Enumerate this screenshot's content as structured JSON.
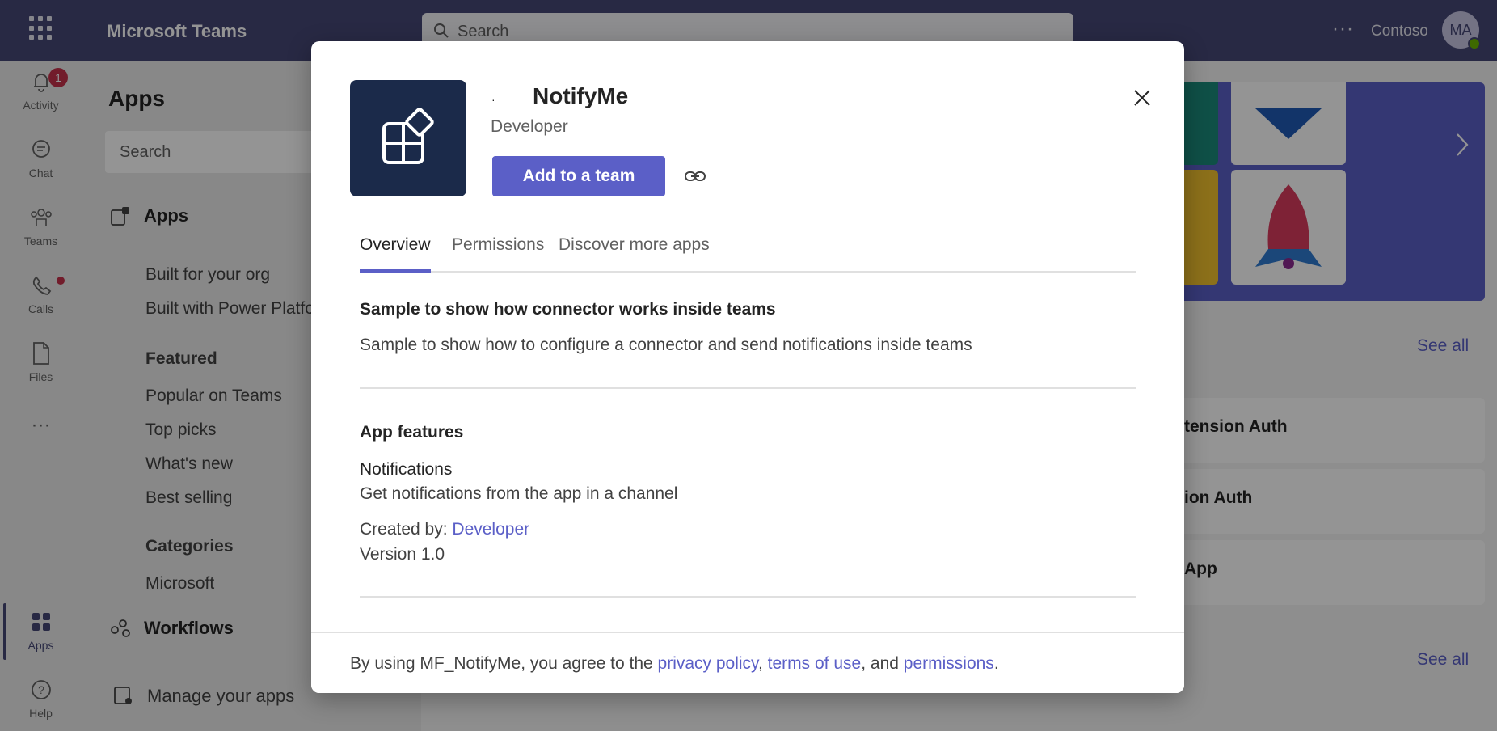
{
  "topbar": {
    "app_name": "Microsoft Teams",
    "search_placeholder": "Search",
    "more_label": "···",
    "tenant": "Contoso",
    "avatar_initials": "MA"
  },
  "rail": {
    "items": [
      {
        "label": "Activity",
        "icon": "bell-icon",
        "badge": "1"
      },
      {
        "label": "Chat",
        "icon": "chat-icon"
      },
      {
        "label": "Teams",
        "icon": "teams-icon"
      },
      {
        "label": "Calls",
        "icon": "phone-icon"
      },
      {
        "label": "Files",
        "icon": "file-icon"
      },
      {
        "label": "Apps",
        "icon": "apps-icon"
      },
      {
        "label": "Help",
        "icon": "help-icon"
      }
    ],
    "more_label": "···"
  },
  "sidebar": {
    "title": "Apps",
    "search_placeholder": "Search",
    "apps_section": "Apps",
    "links": [
      "Built for your org",
      "Built with Power Platfo"
    ],
    "featured_header": "Featured",
    "featured": [
      "Popular on Teams",
      "Top picks",
      "What's new",
      "Best selling"
    ],
    "categories_header": "Categories",
    "categories": [
      "Microsoft"
    ],
    "workflows": "Workflows",
    "manage": "Manage your apps"
  },
  "content": {
    "see_all_1": "See all",
    "see_all_2": "See all",
    "cards": [
      "tension Auth",
      "ion Auth",
      "App"
    ]
  },
  "dialog": {
    "app_title": "NotifyMe",
    "title_mark": "·",
    "developer": "Developer",
    "add_button": "Add to a team",
    "tabs": [
      "Overview",
      "Permissions",
      "Discover more apps"
    ],
    "description_title": "Sample to show how connector works inside teams",
    "description_text": "Sample to show how to configure a connector and send notifications inside teams",
    "features_title": "App features",
    "feature_name": "Notifications",
    "feature_desc": "Get notifications from the app in a channel",
    "created_by_label": "Created by: ",
    "created_by_link": "Developer",
    "version": "Version 1.0",
    "footer": {
      "prefix": "By using MF_NotifyMe, you agree to the ",
      "privacy": "privacy policy",
      "sep1": ", ",
      "terms": "terms of use",
      "sep2": ", and ",
      "permissions": "permissions",
      "end": "."
    }
  },
  "colors": {
    "brand": "#5b5fc7",
    "topbar": "#464775",
    "icon_bg": "#1b2a4a"
  }
}
